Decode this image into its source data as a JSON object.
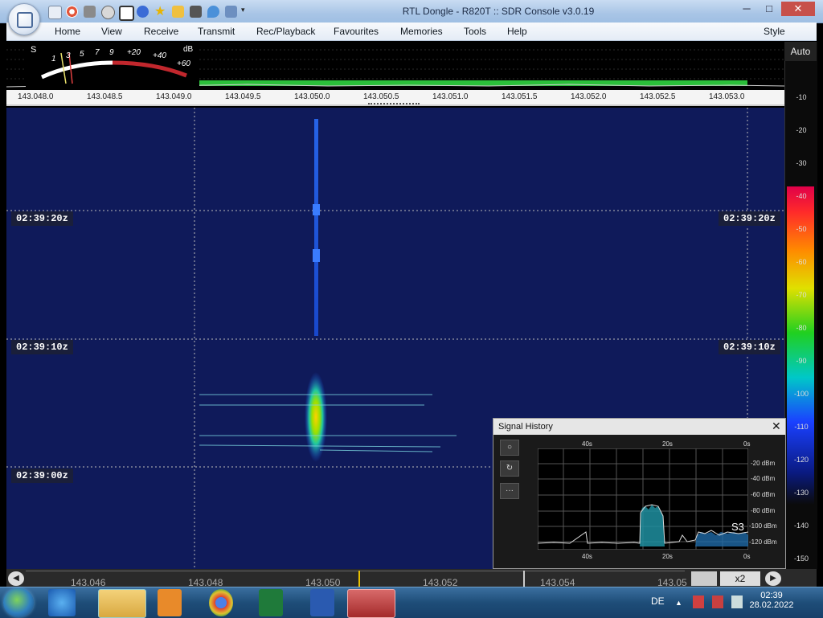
{
  "window": {
    "title": "RTL Dongle - R820T :: SDR Console v3.0.19",
    "minimize": "─",
    "maximize": "□",
    "close": "✕"
  },
  "quick_access_icons": [
    "home-icon",
    "lifebuoy-icon",
    "folder-icon",
    "play-icon",
    "stop-icon",
    "plus-icon",
    "star-icon",
    "lock-icon",
    "camera-icon",
    "drop-icon",
    "link-icon",
    "dropdown-icon"
  ],
  "menu": {
    "items": [
      "Home",
      "View",
      "Receive",
      "Transmit",
      "Rec/Playback",
      "Favourites",
      "Memories",
      "Tools",
      "Help"
    ],
    "style_label": "Style"
  },
  "smeter": {
    "s_label": "S",
    "db_label": "dB",
    "scale": [
      "1",
      "3",
      "5",
      "7",
      "9",
      "+20",
      "+40",
      "+60"
    ]
  },
  "frequency_scale": [
    "143.048.0",
    "143.048.5",
    "143.049.0",
    "143.049.5",
    "143.050.0",
    "143.050.5",
    "143.051.0",
    "143.051.5",
    "143.052.0",
    "143.052.5",
    "143.053.0"
  ],
  "waterfall": {
    "time_labels": [
      "02:39:20z",
      "02:39:10z",
      "02:39:00z"
    ]
  },
  "db_scale": {
    "auto_label": "Auto",
    "levels": [
      "-10",
      "-20",
      "-30",
      "-40",
      "-50",
      "-60",
      "-70",
      "-80",
      "-90",
      "-100",
      "-110",
      "-120",
      "-130",
      "-140",
      "-150"
    ]
  },
  "bottom_bar": {
    "frequencies": [
      "143.046",
      "143.048",
      "143.050",
      "143.052",
      "143.054",
      "143.05"
    ],
    "zoom": "x2"
  },
  "signal_history": {
    "title": "Signal History",
    "close": "✕",
    "time_labels": [
      "40s",
      "20s",
      "0s"
    ],
    "db_labels": [
      "-20 dBm",
      "-40 dBm",
      "-60 dBm",
      "-80 dBm",
      "-100 dBm",
      "-120 dBm"
    ],
    "s_reading": "S3",
    "buttons": [
      "○",
      "↻",
      "···"
    ]
  },
  "taskbar": {
    "language": "DE",
    "time": "02:39",
    "date": "28.02.2022",
    "apps": [
      "internet-explorer-icon",
      "file-explorer-icon",
      "media-player-icon",
      "chrome-icon",
      "excel-icon",
      "word-icon",
      "sdr-console-icon"
    ]
  }
}
